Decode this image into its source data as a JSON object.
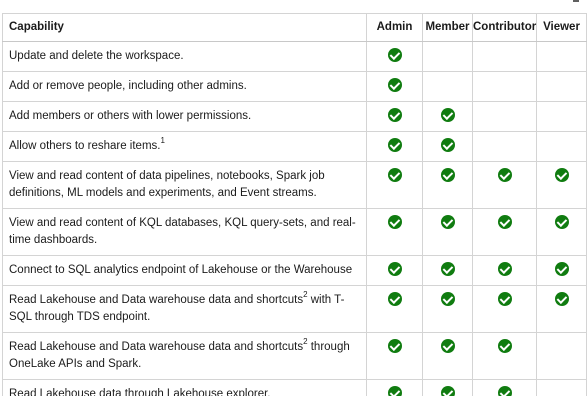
{
  "table": {
    "headers": {
      "capability": "Capability",
      "admin": "Admin",
      "member": "Member",
      "contributor": "Contributor",
      "viewer": "Viewer"
    },
    "rows": [
      {
        "text": "Update and delete the workspace.",
        "sup": "",
        "tail": "",
        "admin": true,
        "member": false,
        "contributor": false,
        "viewer": false
      },
      {
        "text": "Add or remove people, including other admins.",
        "sup": "",
        "tail": "",
        "admin": true,
        "member": false,
        "contributor": false,
        "viewer": false
      },
      {
        "text": "Add members or others with lower permissions.",
        "sup": "",
        "tail": "",
        "admin": true,
        "member": true,
        "contributor": false,
        "viewer": false
      },
      {
        "text": "Allow others to reshare items.",
        "sup": "1",
        "tail": "",
        "admin": true,
        "member": true,
        "contributor": false,
        "viewer": false
      },
      {
        "text": "View and read content of data pipelines, notebooks, Spark job definitions, ML models and experiments, and Event streams.",
        "sup": "",
        "tail": "",
        "admin": true,
        "member": true,
        "contributor": true,
        "viewer": true
      },
      {
        "text": "View and read content of KQL databases, KQL query-sets, and real-time dashboards.",
        "sup": "",
        "tail": "",
        "admin": true,
        "member": true,
        "contributor": true,
        "viewer": true
      },
      {
        "text": "Connect to SQL analytics endpoint of Lakehouse or the Warehouse",
        "sup": "",
        "tail": "",
        "admin": true,
        "member": true,
        "contributor": true,
        "viewer": true
      },
      {
        "text": "Read Lakehouse and Data warehouse data and shortcuts",
        "sup": "2",
        "tail": " with T-SQL through TDS endpoint.",
        "admin": true,
        "member": true,
        "contributor": true,
        "viewer": true
      },
      {
        "text": "Read Lakehouse and Data warehouse data and shortcuts",
        "sup": "2",
        "tail": " through OneLake APIs and Spark.",
        "admin": true,
        "member": true,
        "contributor": true,
        "viewer": false
      },
      {
        "text": "Read Lakehouse data through Lakehouse explorer.",
        "sup": "",
        "tail": "",
        "admin": true,
        "member": true,
        "contributor": true,
        "viewer": false
      }
    ]
  },
  "colors": {
    "check": "#107c10",
    "border": "#d4d4d4"
  },
  "icons": {
    "check": "check-circle-icon"
  }
}
